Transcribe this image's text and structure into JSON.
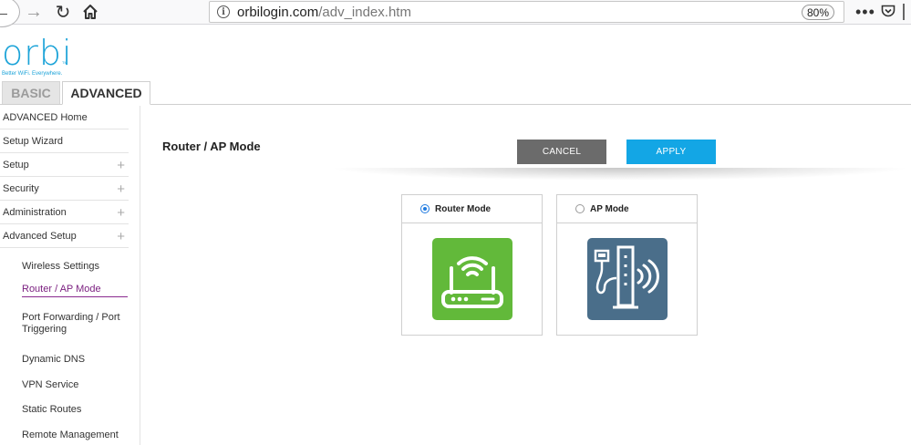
{
  "browser": {
    "url_domain": "orbilogin.com",
    "url_path": "/adv_index.htm",
    "zoom": "80%"
  },
  "logo": {
    "name": "orbi",
    "trademark": "TM",
    "tagline": "Better WiFi. Everywhere."
  },
  "tabs": {
    "basic": "BASIC",
    "advanced": "ADVANCED"
  },
  "sidebar": {
    "items": [
      {
        "label": "ADVANCED Home"
      },
      {
        "label": "Setup Wizard"
      },
      {
        "label": "Setup"
      },
      {
        "label": "Security"
      },
      {
        "label": "Administration"
      },
      {
        "label": "Advanced Setup"
      }
    ],
    "subitems": [
      {
        "label": "Wireless Settings"
      },
      {
        "label": "Router / AP Mode"
      },
      {
        "label": "Port Forwarding / Port Triggering"
      },
      {
        "label": "Dynamic DNS"
      },
      {
        "label": "VPN Service"
      },
      {
        "label": "Static Routes"
      },
      {
        "label": "Remote Management"
      }
    ]
  },
  "main": {
    "title": "Router / AP Mode",
    "cancel_label": "CANCEL",
    "apply_label": "APPLY",
    "modes": [
      {
        "label": "Router Mode",
        "selected": true
      },
      {
        "label": "AP Mode",
        "selected": false
      }
    ]
  },
  "colors": {
    "brand": "#1ba3d8",
    "apply": "#13a6e5",
    "cancel": "#6b6b6b",
    "router_icon": "#62b93a",
    "ap_icon": "#4a6e8a",
    "active_nav": "#7a1e7f"
  }
}
